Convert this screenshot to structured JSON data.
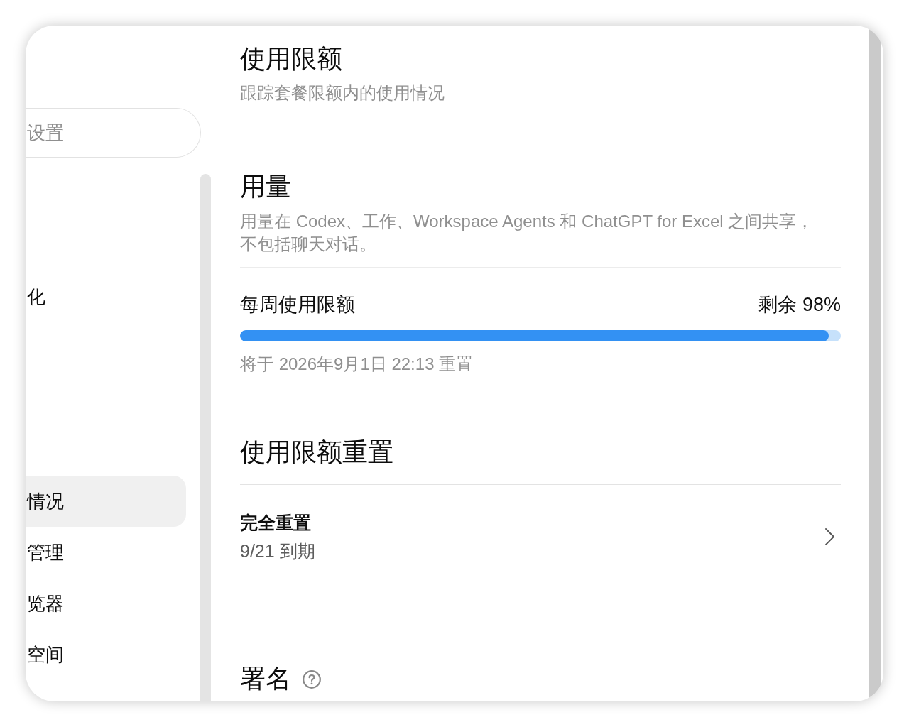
{
  "sidebar": {
    "search": {
      "placeholder": "设置"
    },
    "items": [
      {
        "label": "化",
        "selected": false
      },
      {
        "label": "情况",
        "selected": true
      },
      {
        "label": "管理",
        "selected": false
      },
      {
        "label": "览器",
        "selected": false
      },
      {
        "label": "空间",
        "selected": false
      }
    ]
  },
  "page": {
    "title": "使用限额",
    "subtitle": "跟踪套餐限额内的使用情况"
  },
  "usage": {
    "heading": "用量",
    "description": "用量在 Codex、工作、Workspace Agents 和 ChatGPT for Excel 之间共享，不包括聊天对话。",
    "limits": [
      {
        "label": "每周使用限额",
        "remaining": "剩余 98%",
        "level": 0.98,
        "reset_note": "将于 2026年9月1日 22:13 重置"
      }
    ]
  },
  "limit_resets": {
    "heading": "使用限额重置",
    "options": [
      {
        "title": "完全重置",
        "expiry": "9/21 到期"
      }
    ]
  },
  "attribution": {
    "heading": "署名"
  }
}
